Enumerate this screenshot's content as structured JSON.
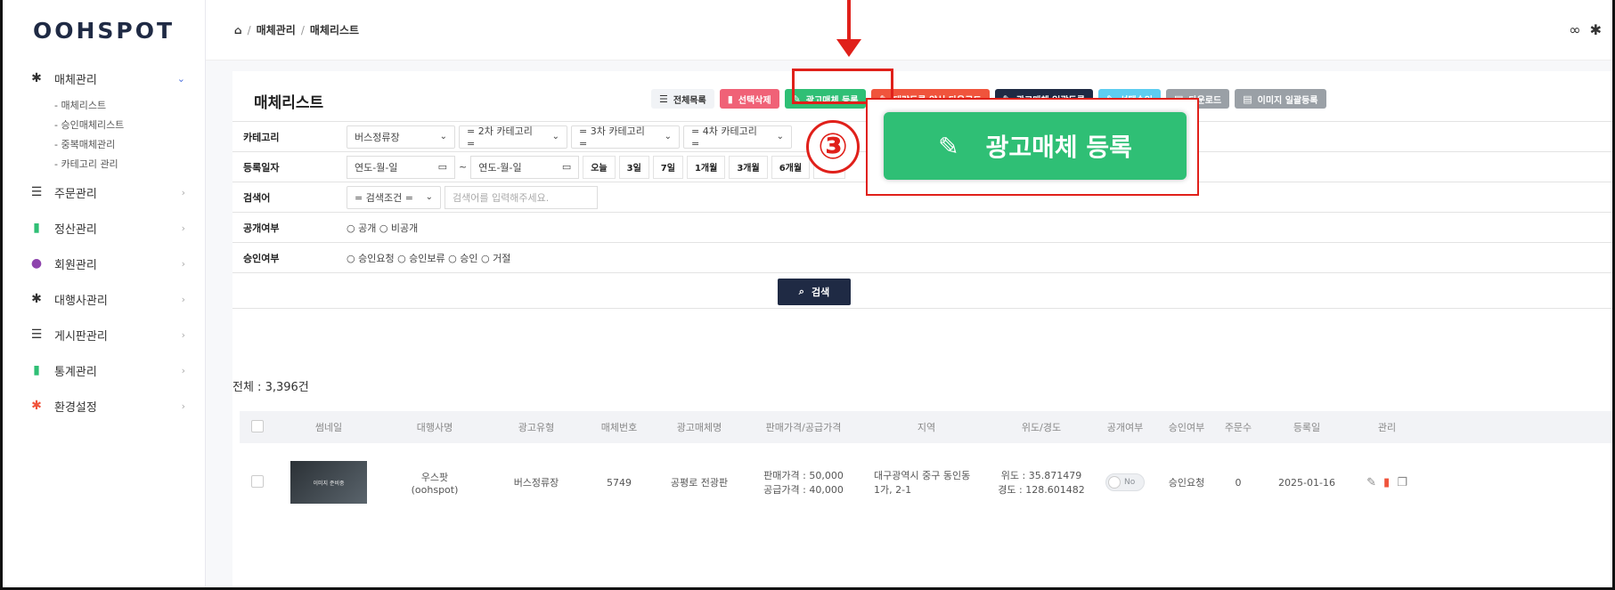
{
  "brand": {
    "logo": "OOHSPOT"
  },
  "sidebar": {
    "items": [
      {
        "label": "매체관리",
        "icon": "gear-icon",
        "color": "#333333",
        "expanded": true,
        "sub": [
          "- 매체리스트",
          "- 승인매체리스트",
          "- 중복매체관리",
          "- 카테고리 관리"
        ]
      },
      {
        "label": "주문관리",
        "icon": "list-icon",
        "color": "#333333"
      },
      {
        "label": "정산관리",
        "icon": "bar-chart-icon",
        "color": "#2fbf75"
      },
      {
        "label": "회원관리",
        "icon": "user-edit-icon",
        "color": "#8e44ad"
      },
      {
        "label": "대행사관리",
        "icon": "gear-icon",
        "color": "#333333"
      },
      {
        "label": "게시판관리",
        "icon": "list-icon",
        "color": "#333333"
      },
      {
        "label": "통계관리",
        "icon": "bar-chart-icon",
        "color": "#2fbf75"
      },
      {
        "label": "환경설정",
        "icon": "gear-icon",
        "color": "#f0543c"
      }
    ]
  },
  "breadcrumb": {
    "home_icon": "home-icon",
    "level1": "매체관리",
    "level2": "매체리스트",
    "sep": "/"
  },
  "page": {
    "title": "매체리스트"
  },
  "actions": {
    "all_list": "전체목록",
    "delete_selected": "선택삭제",
    "register": "광고매체 등록",
    "bulk_form_download": "대량등록 양식 다운로드",
    "bulk_register": "광고매체 일괄등록",
    "approve_selected": "선택승인",
    "download": "다운로드",
    "image_bulk_register": "이미지 일괄등록"
  },
  "filters": {
    "category_label": "카테고리",
    "category1": "버스정류장",
    "category2": "= 2차 카테고리 =",
    "category3": "= 3차 카테고리 =",
    "category4": "= 4차 카테고리 =",
    "date_label": "등록일자",
    "date_from": "연도-월-일",
    "date_to": "연도-월-일",
    "date_tilde": "~",
    "periods": [
      "오늘",
      "3일",
      "7일",
      "1개월",
      "3개월",
      "6개월",
      "전체"
    ],
    "keyword_label": "검색어",
    "condition": "= 검색조건 =",
    "keyword_placeholder": "검색어를 입력해주세요.",
    "public_label": "공개여부",
    "public_options": "○ 공개 ○ 비공개",
    "approval_label": "승인여부",
    "approval_options": "○ 승인요청 ○ 승인보류 ○ 승인 ○ 거절",
    "search_button": "검색"
  },
  "total": "전체 : 3,396건",
  "table": {
    "headers": [
      "썸네일",
      "대행사명",
      "광고유형",
      "매체번호",
      "광고매체명",
      "판매가격/공급가격",
      "지역",
      "위도/경도",
      "공개여부",
      "승인여부",
      "주문수",
      "등록일",
      "관리"
    ],
    "row": {
      "thumb_text": "이미지 준비중",
      "agency": "우스팟",
      "agency_sub": "(oohspot)",
      "type": "버스정류장",
      "number": "5749",
      "name": "공평로 전광판",
      "price_sale": "판매가격 : 50,000",
      "price_supply": "공급가격 : 40,000",
      "region1": "대구광역시 중구 동인동",
      "region2": "1가, 2-1",
      "lat": "위도 : 35.871479",
      "lng": "경도 : 128.601482",
      "public": "No",
      "approval": "승인요청",
      "orders": "0",
      "date": "2025-01-16"
    }
  },
  "annotation": {
    "step": "③",
    "callout_label": "광고매체 등록",
    "color": "#e0201a"
  }
}
